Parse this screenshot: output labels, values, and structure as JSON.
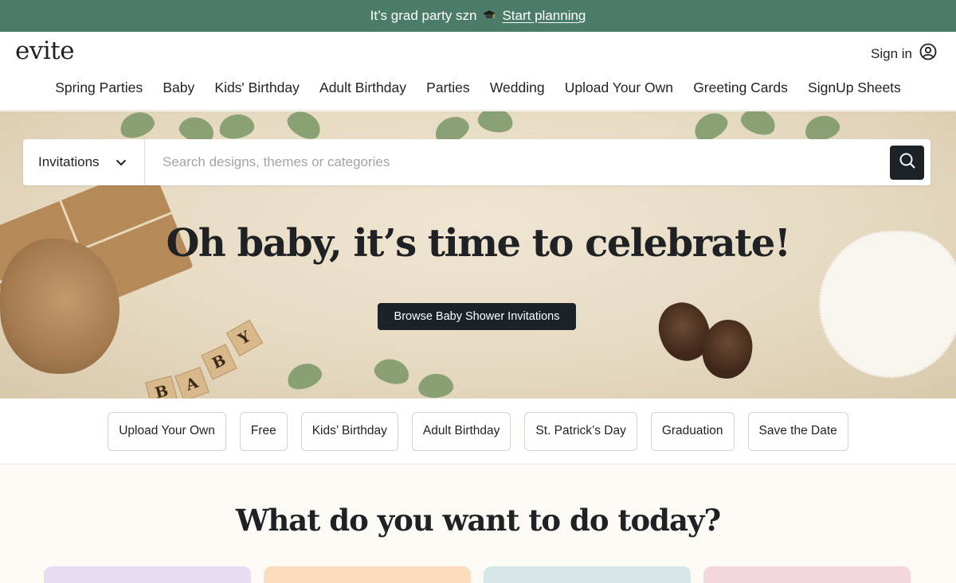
{
  "promo": {
    "text": "It’s grad party szn",
    "cap_icon": "graduation-cap-icon",
    "link": "Start planning"
  },
  "header": {
    "logo": "evite",
    "signin": "Sign in",
    "nav": [
      "Spring Parties",
      "Baby",
      "Kids' Birthday",
      "Adult Birthday",
      "Parties",
      "Wedding",
      "Upload Your Own",
      "Greeting Cards",
      "SignUp Sheets"
    ]
  },
  "hero": {
    "search_category": "Invitations",
    "search_placeholder": "Search designs, themes or categories",
    "title": "Oh baby, it’s time to celebrate!",
    "cta": "Browse Baby Shower Invitations",
    "blocks": [
      "B",
      "A",
      "B",
      "Y"
    ]
  },
  "chips": [
    "Upload Your Own",
    "Free",
    "Kids’ Birthday",
    "Adult Birthday",
    "St. Patrick’s Day",
    "Graduation",
    "Save the Date"
  ],
  "section": {
    "title": "What do you want to do today?"
  },
  "colors": {
    "promo_bg": "#4b7c67",
    "button_dark": "#1b2228",
    "tile_1": "#e8dcf2",
    "tile_2": "#fbdcbd",
    "tile_3": "#d6e6e9",
    "tile_4": "#f4d7dc"
  }
}
